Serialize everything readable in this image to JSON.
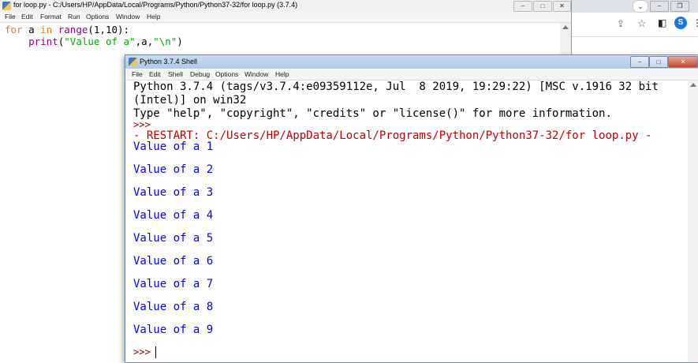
{
  "browser": {
    "avatar_letter": "S",
    "icons": [
      "chevron-down-icon",
      "share-icon",
      "star-icon",
      "sidebar-icon",
      "profile-avatar",
      "kebab-menu-icon"
    ]
  },
  "editor": {
    "title": "for loop.py - C:/Users/HP/AppData/Local/Programs/Python/Python37-32/for loop.py (3.7.4)",
    "menu": [
      "File",
      "Edit",
      "Format",
      "Run",
      "Options",
      "Window",
      "Help"
    ],
    "window_buttons": [
      "–",
      "□",
      "✕"
    ],
    "code": {
      "line1": {
        "kw1": "for",
        "var": " a ",
        "kw2": "in",
        "sp": " ",
        "builtin": "range",
        "rest": "(1,10):"
      },
      "line2": {
        "indent": "    ",
        "builtin": "print",
        "open": "(",
        "str": "\"Value of a\"",
        "mid": ",a,",
        "str2": "\"\\n\"",
        "close": ")"
      }
    }
  },
  "shell": {
    "title": "Python 3.7.4 Shell",
    "menu": [
      "File",
      "Edit",
      "Shell",
      "Debug",
      "Options",
      "Window",
      "Help"
    ],
    "window_buttons": [
      "–",
      "□",
      "✕"
    ],
    "banner1": "Python 3.7.4 (tags/v3.7.4:e09359112e, Jul  8 2019, 19:29:22) [MSC v.1916 32 bit",
    "banner2": "(Intel)] on win32",
    "banner3": "Type \"help\", \"copyright\", \"credits\" or \"license()\" for more information.",
    "prompt": ">>>",
    "restart": "- RESTART: C:/Users/HP/AppData/Local/Programs/Python/Python37-32/for loop.py -",
    "outputs": [
      "Value of a 1",
      "Value of a 2",
      "Value of a 3",
      "Value of a 4",
      "Value of a 5",
      "Value of a 6",
      "Value of a 7",
      "Value of a 8",
      "Value of a 9"
    ],
    "final_prompt": ">>>"
  }
}
